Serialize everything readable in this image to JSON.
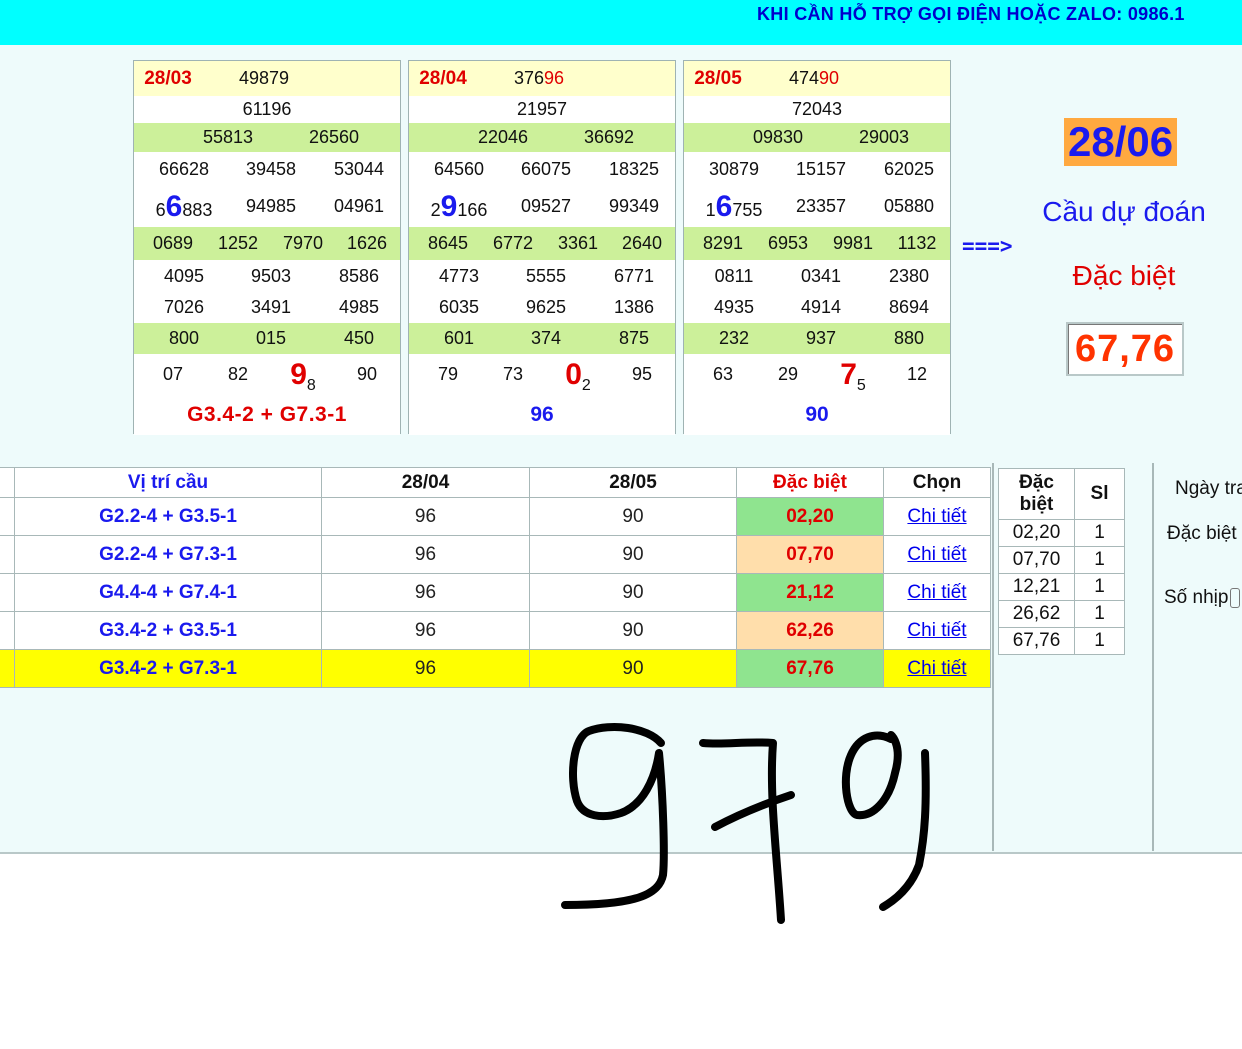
{
  "topbar": {
    "text": "KHI CẦN HỖ TRỢ GỌI ĐIỆN HOẶC ZALO: 0986.1"
  },
  "panels": [
    {
      "date": "28/03",
      "db_prefix": "49879",
      "db_suffix": "",
      "g1": "61196",
      "g2": [
        "55813",
        "26560"
      ],
      "g3a": [
        "66628",
        "39458",
        "53044"
      ],
      "g3b": [
        {
          "pre": "6",
          "big": "6",
          "post": "883"
        },
        "94985",
        "04961"
      ],
      "g4": [
        "0689",
        "1252",
        "7970",
        "1626"
      ],
      "g5a": [
        "4095",
        "9503",
        "8586"
      ],
      "g5b": [
        "7026",
        "3491",
        "4985"
      ],
      "g6": [
        "800",
        "015",
        "450"
      ],
      "g7": [
        "07",
        "82",
        {
          "big": "9",
          "sub": "8"
        },
        "90"
      ],
      "formula": "G3.4-2 + G7.3-1"
    },
    {
      "date": "28/04",
      "db_prefix": "376",
      "db_suffix": "96",
      "g1": "21957",
      "g2": [
        "22046",
        "36692"
      ],
      "g3a": [
        "64560",
        "66075",
        "18325"
      ],
      "g3b": [
        {
          "pre": "2",
          "big": "9",
          "post": "166"
        },
        "09527",
        "99349"
      ],
      "g4": [
        "8645",
        "6772",
        "3361",
        "2640"
      ],
      "g5a": [
        "4773",
        "5555",
        "6771"
      ],
      "g5b": [
        "6035",
        "9625",
        "1386"
      ],
      "g6": [
        "601",
        "374",
        "875"
      ],
      "g7": [
        "79",
        "73",
        {
          "big": "0",
          "sub": "2"
        },
        "95"
      ],
      "formula": "96"
    },
    {
      "date": "28/05",
      "db_prefix": "474",
      "db_suffix": "90",
      "g1": "72043",
      "g2": [
        "09830",
        "29003"
      ],
      "g3a": [
        "30879",
        "15157",
        "62025"
      ],
      "g3b": [
        {
          "pre": "1",
          "big": "6",
          "post": "755"
        },
        "23357",
        "05880"
      ],
      "g4": [
        "8291",
        "6953",
        "9981",
        "1132"
      ],
      "g5a": [
        "0811",
        "0341",
        "2380"
      ],
      "g5b": [
        "4935",
        "4914",
        "8694"
      ],
      "g6": [
        "232",
        "937",
        "880"
      ],
      "g7": [
        "63",
        "29",
        {
          "big": "7",
          "sub": "5"
        },
        "12"
      ],
      "formula": "90"
    }
  ],
  "prediction": {
    "arrow": "===>",
    "date": "28/06",
    "label1": "Cầu dự đoán",
    "label2": "Đặc biệt",
    "value": "67,76"
  },
  "main_table": {
    "headers": {
      "pos": "Vị trí cầu",
      "d1": "28/04",
      "d2": "28/05",
      "special": "Đặc biệt",
      "choose": "Chọn"
    },
    "rows": [
      {
        "pos": "G2.2-4 + G3.5-1",
        "d1": "96",
        "d2": "90",
        "special": "02,20",
        "link": "Chi tiết",
        "special_color": "#8fe48f",
        "highlight": false
      },
      {
        "pos": "G2.2-4 + G7.3-1",
        "d1": "96",
        "d2": "90",
        "special": "07,70",
        "link": "Chi tiết",
        "special_color": "#ffdeab",
        "highlight": false
      },
      {
        "pos": "G4.4-4 + G7.4-1",
        "d1": "96",
        "d2": "90",
        "special": "21,12",
        "link": "Chi tiết",
        "special_color": "#8fe48f",
        "highlight": false
      },
      {
        "pos": "G3.4-2 + G3.5-1",
        "d1": "96",
        "d2": "90",
        "special": "62,26",
        "link": "Chi tiết",
        "special_color": "#ffdeab",
        "highlight": false
      },
      {
        "pos": "G3.4-2 + G7.3-1",
        "d1": "96",
        "d2": "90",
        "special": "67,76",
        "link": "Chi tiết",
        "special_color": "#8fe48f",
        "highlight": true
      }
    ]
  },
  "side_table": {
    "header_special_1": "Đặc",
    "header_special_2": "biệt",
    "header_sl": "Sl",
    "rows": [
      {
        "special": "02,20",
        "sl": "1"
      },
      {
        "special": "07,70",
        "sl": "1"
      },
      {
        "special": "12,21",
        "sl": "1"
      },
      {
        "special": "26,62",
        "sl": "1"
      },
      {
        "special": "67,76",
        "sl": "1"
      }
    ]
  },
  "right_form": {
    "date_label": "Ngày tra",
    "special_label": "Đặc biệt",
    "beat_label": "Số nhịp"
  },
  "handwriting": {
    "text": "979",
    "color": "#000000"
  }
}
